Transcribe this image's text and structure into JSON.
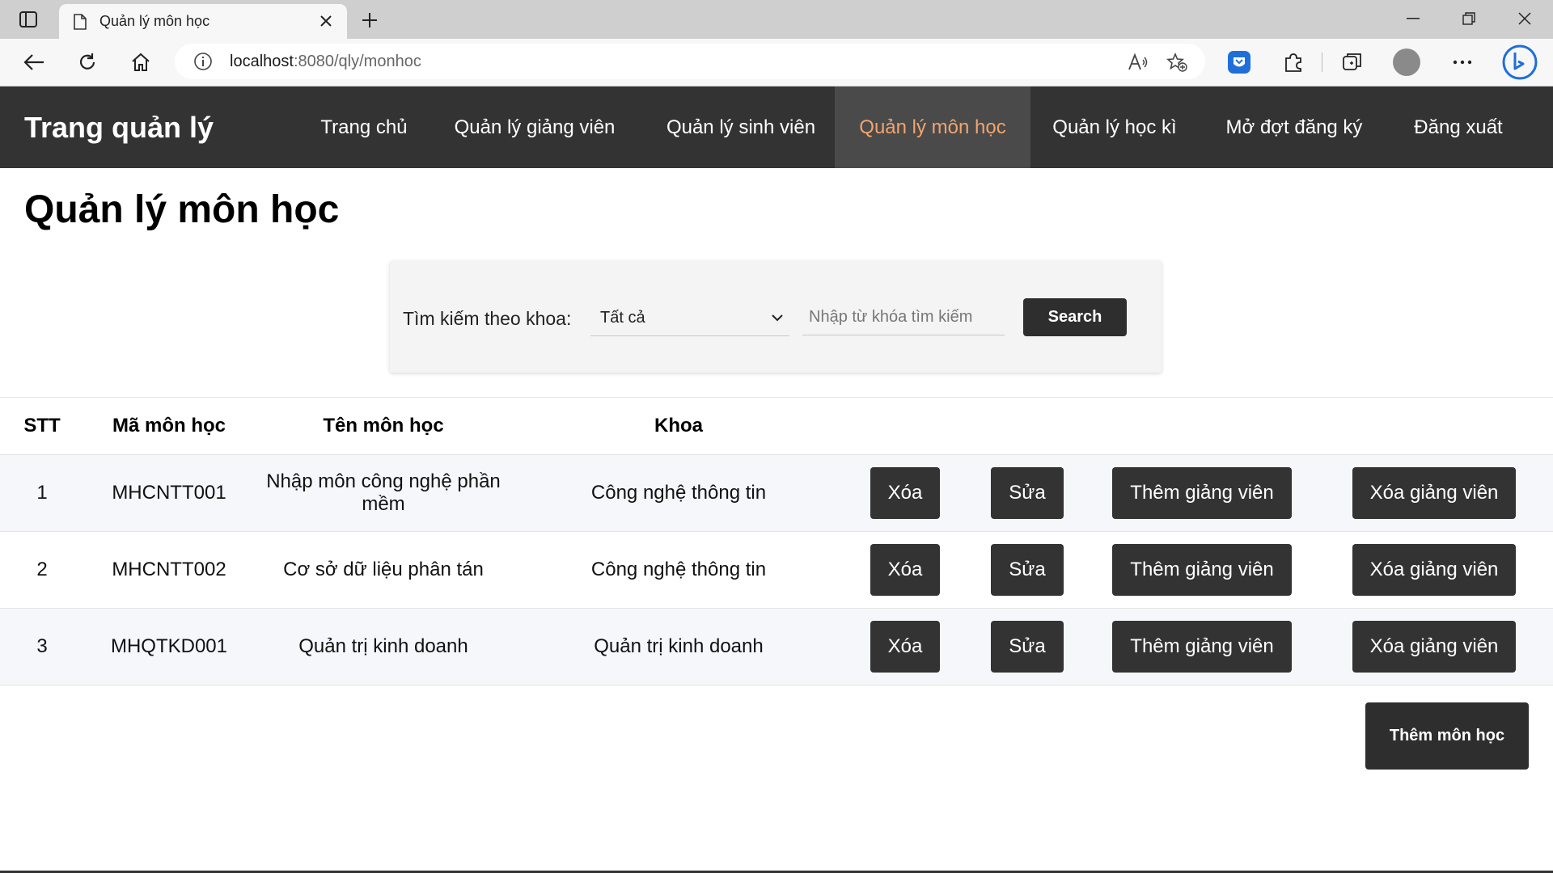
{
  "browser": {
    "tab_title": "Quản lý môn học",
    "url_host": "localhost",
    "url_rest": ":8080/qly/monhoc"
  },
  "nav": {
    "brand": "Trang quản lý",
    "links": [
      "Trang chủ",
      "Quản lý giảng viên",
      "Quản lý sinh viên",
      "Quản lý môn học",
      "Quản lý học kì",
      "Mở đợt đăng ký",
      "Đăng xuất"
    ],
    "active_index": 3
  },
  "page": {
    "title": "Quản lý môn học"
  },
  "search": {
    "label": "Tìm kiếm theo khoa:",
    "selected": "Tất cả",
    "placeholder": "Nhập từ khóa tìm kiếm",
    "button": "Search"
  },
  "table": {
    "headers": [
      "STT",
      "Mã môn học",
      "Tên môn học",
      "Khoa"
    ],
    "rows": [
      {
        "stt": "1",
        "code": "MHCNTT001",
        "name": "Nhập môn công nghệ phần mềm",
        "faculty": "Công nghệ thông tin"
      },
      {
        "stt": "2",
        "code": "MHCNTT002",
        "name": "Cơ sở dữ liệu phân tán",
        "faculty": "Công nghệ thông tin"
      },
      {
        "stt": "3",
        "code": "MHQTKD001",
        "name": "Quản trị kinh doanh",
        "faculty": "Quản trị kinh doanh"
      }
    ],
    "actions": {
      "delete": "Xóa",
      "edit": "Sửa",
      "add_lecturer": "Thêm giảng viên",
      "remove_lecturer": "Xóa giảng viên"
    }
  },
  "footer": {
    "add_subject": "Thêm môn học"
  },
  "colors": {
    "nav_bg": "#333333",
    "active_link": "#f2a46e",
    "button_bg": "#333333"
  }
}
